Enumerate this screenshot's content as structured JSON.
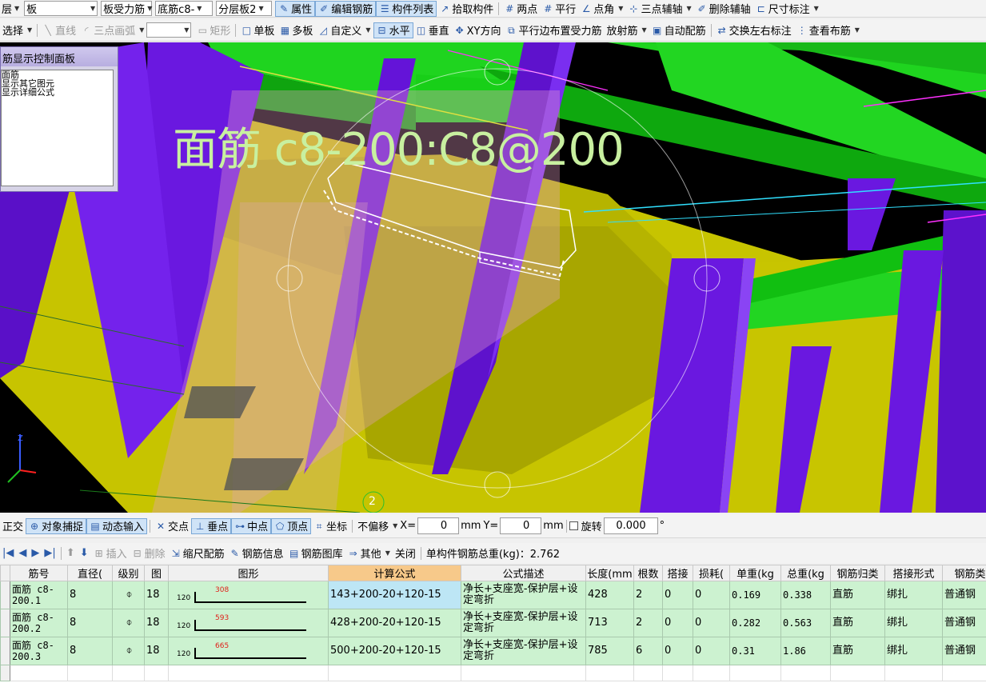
{
  "toolbar1": {
    "dropdowns": [
      "层",
      "板",
      "板受力筋",
      "底筋c8-",
      "分层板2"
    ],
    "buttons": [
      "属性",
      "编辑钢筋",
      "构件列表",
      "拾取构件",
      "两点",
      "平行",
      "点角",
      "三点辅轴",
      "删除辅轴",
      "尺寸标注"
    ]
  },
  "toolbar2": {
    "items": [
      "选择",
      "直线",
      "三点画弧",
      "矩形",
      "单板",
      "多板",
      "自定义",
      "水平",
      "垂直",
      "XY方向",
      "平行边布置受力筋",
      "放射筋",
      "自动配筋",
      "交换左右标注",
      "查看布筋"
    ]
  },
  "panel": {
    "title": "筋显示控制面板",
    "items": [
      "面筋",
      "显示其它图元",
      "显示详细公式"
    ]
  },
  "viewport": {
    "annotation": "面筋 c8-200:C8@200",
    "marker": "2"
  },
  "snapbar": {
    "items": [
      "正交",
      "对象捕捉",
      "动态输入",
      "交点",
      "垂点",
      "中点",
      "顶点",
      "坐标"
    ],
    "offset_mode": "不偏移",
    "x_label": "X=",
    "x_value": "0",
    "x_unit": "mm",
    "y_label": "Y=",
    "y_value": "0",
    "y_unit": "mm",
    "rotate_label": "旋转",
    "rotate_value": "0.000",
    "degree": "°"
  },
  "rebarbar": {
    "items": [
      "插入",
      "删除",
      "缩尺配筋",
      "钢筋信息",
      "钢筋图库",
      "其他",
      "关闭"
    ],
    "total_weight_label": "单构件钢筋总重(kg)：2.762"
  },
  "table": {
    "headers": [
      "筋号",
      "直径(",
      "级别",
      "图",
      "图形",
      "计算公式",
      "公式描述",
      "长度(mm",
      "根数",
      "搭接",
      "损耗(",
      "单重(kg",
      "总重(kg",
      "钢筋归类",
      "搭接形式",
      "钢筋类"
    ],
    "rows": [
      {
        "name": "面筋 c8-200.1",
        "dia": "8",
        "grade": "⌽",
        "fig": "18",
        "hook": "120",
        "len_label": "308",
        "formula": "143+200-20+120-15",
        "desc": "净长+支座宽-保护层+设定弯折",
        "length": "428",
        "count": "2",
        "lap": "0",
        "loss": "0",
        "unit_w": "0.169",
        "total_w": "0.338",
        "type": "直筋",
        "lap_form": "绑扎",
        "bar_kind": "普通钢"
      },
      {
        "name": "面筋 c8-200.2",
        "dia": "8",
        "grade": "⌽",
        "fig": "18",
        "hook": "120",
        "len_label": "593",
        "formula": "428+200-20+120-15",
        "desc": "净长+支座宽-保护层+设定弯折",
        "length": "713",
        "count": "2",
        "lap": "0",
        "loss": "0",
        "unit_w": "0.282",
        "total_w": "0.563",
        "type": "直筋",
        "lap_form": "绑扎",
        "bar_kind": "普通钢"
      },
      {
        "name": "面筋 c8-200.3",
        "dia": "8",
        "grade": "⌽",
        "fig": "18",
        "hook": "120",
        "len_label": "665",
        "formula": "500+200-20+120-15",
        "desc": "净长+支座宽-保护层+设定弯折",
        "length": "785",
        "count": "6",
        "lap": "0",
        "loss": "0",
        "unit_w": "0.31",
        "total_w": "1.86",
        "type": "直筋",
        "lap_form": "绑扎",
        "bar_kind": "普通钢"
      }
    ]
  }
}
